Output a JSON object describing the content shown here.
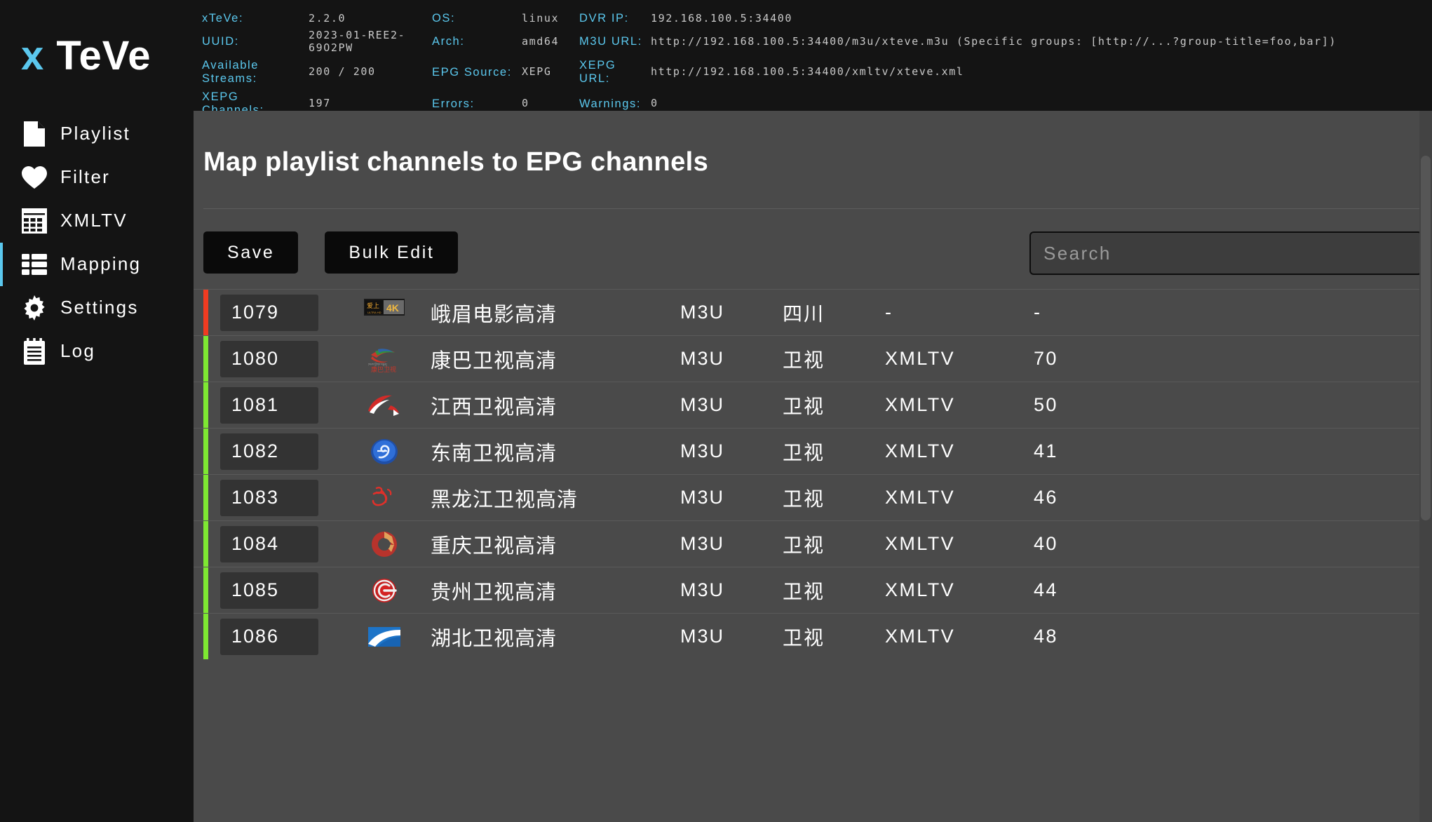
{
  "brand": {
    "x": "x",
    "rest": "TeVe"
  },
  "sidebar": {
    "items": [
      {
        "label": "Playlist",
        "icon": "file-icon",
        "active": false
      },
      {
        "label": "Filter",
        "icon": "heart-icon",
        "active": false
      },
      {
        "label": "XMLTV",
        "icon": "grid-icon",
        "active": false
      },
      {
        "label": "Mapping",
        "icon": "list-icon",
        "active": true
      },
      {
        "label": "Settings",
        "icon": "gear-icon",
        "active": false
      },
      {
        "label": "Log",
        "icon": "notepad-icon",
        "active": false
      }
    ],
    "active_accent": "#5bc8ee"
  },
  "topbar": {
    "xteve_label": "xTeVe:",
    "xteve_value": "2.2.0",
    "uuid_label": "UUID:",
    "uuid_value": "2023-01-REE2-69O2PW",
    "streams_label": "Available Streams:",
    "streams_value": "200 / 200",
    "xepg_channels_label": "XEPG Channels:",
    "xepg_channels_value": "197",
    "os_label": "OS:",
    "os_value": "linux",
    "arch_label": "Arch:",
    "arch_value": "amd64",
    "epg_source_label": "EPG Source:",
    "epg_source_value": "XEPG",
    "errors_label": "Errors:",
    "errors_value": "0",
    "dvr_ip_label": "DVR IP:",
    "dvr_ip_value": "192.168.100.5:34400",
    "m3u_url_label": "M3U URL:",
    "m3u_url_value": "http://192.168.100.5:34400/m3u/xteve.m3u (Specific groups: [http://...?group-title=foo,bar])",
    "xepg_url_label": "XEPG URL:",
    "xepg_url_value": "http://192.168.100.5:34400/xmltv/xteve.xml",
    "warnings_label": "Warnings:",
    "warnings_value": "0"
  },
  "main": {
    "page_title": "Map playlist channels to EPG channels",
    "save_label": "Save",
    "bulk_edit_label": "Bulk Edit",
    "search_placeholder": "Search",
    "search_value": ""
  },
  "table": {
    "rows": [
      {
        "number": "1079",
        "name": "峨眉电影高清",
        "source": "M3U",
        "group": "四川",
        "epg_source": "-",
        "epg_number": "-",
        "status": "red",
        "logo": "emei-4k-logo"
      },
      {
        "number": "1080",
        "name": "康巴卫视高清",
        "source": "M3U",
        "group": "卫视",
        "epg_source": "XMLTV",
        "epg_number": "70",
        "status": "green",
        "logo": "kangba-tv-logo"
      },
      {
        "number": "1081",
        "name": "江西卫视高清",
        "source": "M3U",
        "group": "卫视",
        "epg_source": "XMLTV",
        "epg_number": "50",
        "status": "green",
        "logo": "jiangxi-tv-logo"
      },
      {
        "number": "1082",
        "name": "东南卫视高清",
        "source": "M3U",
        "group": "卫视",
        "epg_source": "XMLTV",
        "epg_number": "41",
        "status": "green",
        "logo": "dongnan-tv-logo"
      },
      {
        "number": "1083",
        "name": "黑龙江卫视高清",
        "source": "M3U",
        "group": "卫视",
        "epg_source": "XMLTV",
        "epg_number": "46",
        "status": "green",
        "logo": "heilongjiang-tv-logo"
      },
      {
        "number": "1084",
        "name": "重庆卫视高清",
        "source": "M3U",
        "group": "卫视",
        "epg_source": "XMLTV",
        "epg_number": "40",
        "status": "green",
        "logo": "chongqing-tv-logo"
      },
      {
        "number": "1085",
        "name": "贵州卫视高清",
        "source": "M3U",
        "group": "卫视",
        "epg_source": "XMLTV",
        "epg_number": "44",
        "status": "green",
        "logo": "guizhou-tv-logo"
      },
      {
        "number": "1086",
        "name": "湖北卫视高清",
        "source": "M3U",
        "group": "卫视",
        "epg_source": "XMLTV",
        "epg_number": "48",
        "status": "green",
        "logo": "hubei-tv-logo"
      }
    ],
    "status_colors": {
      "red": "#f03b21",
      "green": "#7ee832"
    }
  }
}
